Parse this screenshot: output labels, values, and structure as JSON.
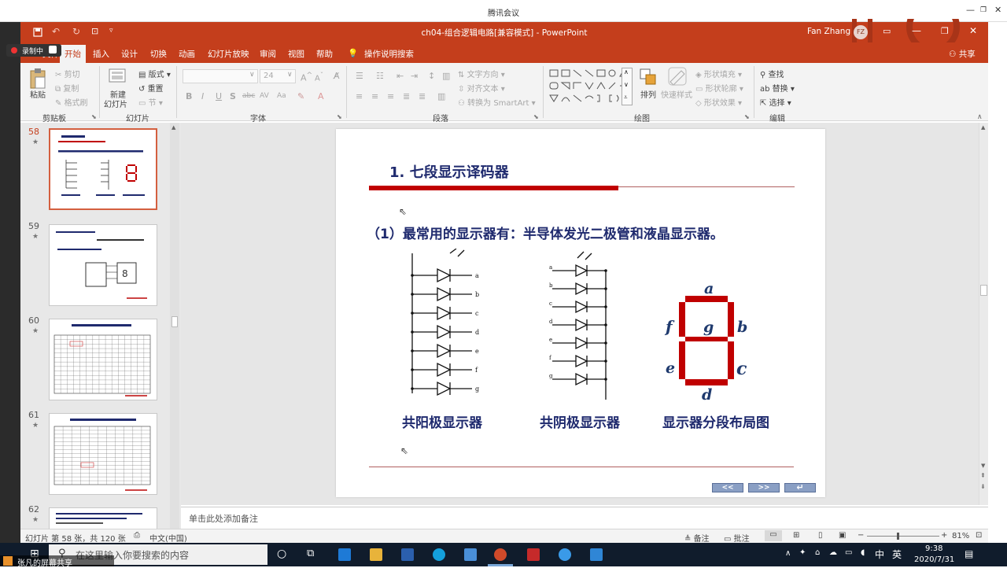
{
  "meeting": {
    "title": "腾讯会议"
  },
  "window": {
    "doc_title": "ch04-组合逻辑电路[兼容模式] - PowerPoint",
    "user": "Fan Zhang",
    "avatar": "FZ",
    "share": "共享"
  },
  "recording": {
    "label": "录制中"
  },
  "tabs": [
    "开始",
    "插入",
    "设计",
    "切换",
    "动画",
    "幻灯片放映",
    "审阅",
    "视图",
    "帮助",
    "操作说明搜索"
  ],
  "file_tab": "文件",
  "ribbon": {
    "paste": "粘贴",
    "cut": "剪切",
    "copy": "复制",
    "format_painter": "格式刷",
    "clipboard": "剪贴板",
    "new_slide_1": "新建",
    "new_slide_2": "幻灯片",
    "layout": "版式",
    "reset": "重置",
    "section": "节",
    "slides": "幻灯片",
    "font_size": "24",
    "font": "字体",
    "text_direction": "文字方向",
    "align_text": "对齐文本",
    "smartart": "转换为 SmartArt",
    "paragraph": "段落",
    "arrange": "排列",
    "quick_styles": "快速样式",
    "shape_fill": "形状填充",
    "shape_outline": "形状轮廓",
    "shape_effects": "形状效果",
    "drawing": "绘图",
    "find": "查找",
    "replace": "替换",
    "select": "选择",
    "editing": "编辑"
  },
  "thumbnails": [
    {
      "num": "58",
      "selected": true
    },
    {
      "num": "59",
      "selected": false
    },
    {
      "num": "60",
      "selected": false
    },
    {
      "num": "61",
      "selected": false
    },
    {
      "num": "62",
      "selected": false
    }
  ],
  "slide": {
    "title": "1. 七段显示译码器",
    "heading": "（1）最常用的显示器有：半导体发光二极管和液晶显示器。",
    "caption_anode": "共阳极显示器",
    "caption_cathode": "共阴极显示器",
    "caption_layout": "显示器分段布局图",
    "segments": [
      "a",
      "b",
      "c",
      "d",
      "e",
      "f",
      "g"
    ],
    "nav_prev": "<<",
    "nav_next": ">>",
    "nav_return": "↵"
  },
  "notes": {
    "placeholder": "单击此处添加备注"
  },
  "status": {
    "slide_info": "幻灯片 第 58 张，共 120 张",
    "language": "中文(中国)",
    "notes_btn": "备注",
    "comments_btn": "批注",
    "zoom": "81%"
  },
  "taskbar": {
    "search_placeholder": "在这里输入你要搜索的内容",
    "time": "9:38",
    "date": "2020/7/31",
    "ime": "中",
    "ime2": "英"
  },
  "share_label": "张凡的屏幕共享",
  "colors": {
    "ppt_red": "#c43e1c",
    "slide_title": "#1f2a6e",
    "segment": "#c00000",
    "segment_label": "#1f3a6e"
  }
}
